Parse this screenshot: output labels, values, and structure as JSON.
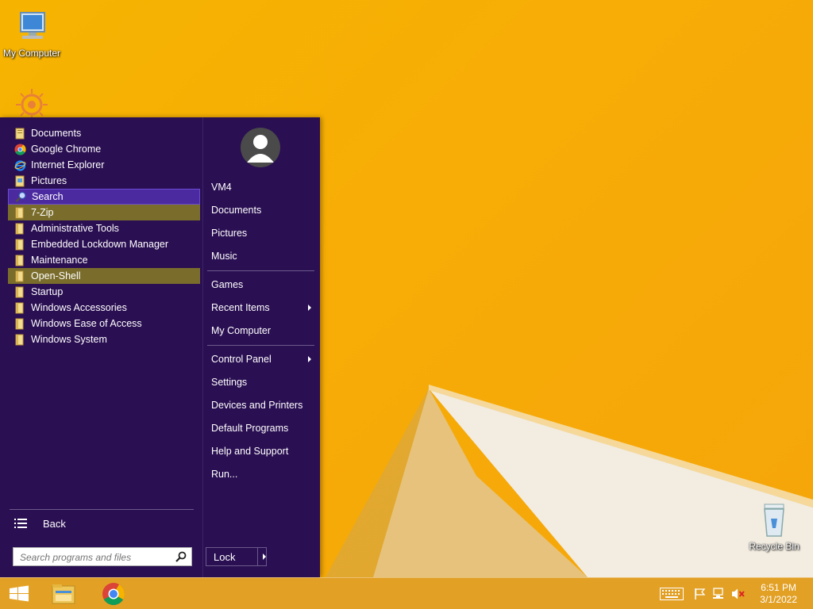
{
  "desktop": {
    "icons": [
      {
        "label": "My Computer",
        "icon": "computer-icon"
      },
      {
        "label": "Recycle Bin",
        "icon": "recycle-bin-icon"
      }
    ]
  },
  "start_menu": {
    "programs": [
      {
        "label": "Documents",
        "icon": "documents-icon",
        "state": "normal"
      },
      {
        "label": "Google Chrome",
        "icon": "chrome-icon",
        "state": "normal"
      },
      {
        "label": "Internet Explorer",
        "icon": "internet-explorer-icon",
        "state": "normal"
      },
      {
        "label": "Pictures",
        "icon": "pictures-icon",
        "state": "normal"
      },
      {
        "label": "Search",
        "icon": "search-icon",
        "state": "selected"
      },
      {
        "label": "7-Zip",
        "icon": "folder-icon",
        "state": "highlighted"
      },
      {
        "label": "Administrative Tools",
        "icon": "folder-icon",
        "state": "normal"
      },
      {
        "label": "Embedded Lockdown Manager",
        "icon": "folder-icon",
        "state": "normal"
      },
      {
        "label": "Maintenance",
        "icon": "folder-icon",
        "state": "normal"
      },
      {
        "label": "Open-Shell",
        "icon": "folder-icon",
        "state": "highlighted"
      },
      {
        "label": "Startup",
        "icon": "folder-icon",
        "state": "normal"
      },
      {
        "label": "Windows Accessories",
        "icon": "folder-icon",
        "state": "normal"
      },
      {
        "label": "Windows Ease of Access",
        "icon": "folder-icon",
        "state": "normal"
      },
      {
        "label": "Windows System",
        "icon": "folder-icon",
        "state": "normal"
      }
    ],
    "back_label": "Back",
    "search_placeholder": "Search programs and files",
    "right_items": [
      {
        "label": "VM4"
      },
      {
        "label": "Documents"
      },
      {
        "label": "Pictures"
      },
      {
        "label": "Music"
      },
      {
        "label": "Games"
      },
      {
        "label": "Recent Items",
        "submenu": true
      },
      {
        "label": "My Computer"
      },
      {
        "label": "Control Panel",
        "submenu": true
      },
      {
        "label": "Settings"
      },
      {
        "label": "Devices and Printers"
      },
      {
        "label": "Default Programs"
      },
      {
        "label": "Help and Support"
      },
      {
        "label": "Run..."
      }
    ],
    "lock_label": "Lock"
  },
  "taskbar": {
    "pinned": [
      "windows-start-icon",
      "file-explorer-icon",
      "chrome-icon"
    ],
    "tray": [
      "keyboard-icon",
      "flag-icon",
      "network-icon",
      "volume-muted-icon"
    ],
    "time": "6:51 PM",
    "date": "3/1/2022"
  },
  "colors": {
    "menu_bg": "#2a0f52",
    "selected": "#4b2aa0",
    "highlight": "#7a6d2c",
    "wallpaper": "#f6b400"
  }
}
